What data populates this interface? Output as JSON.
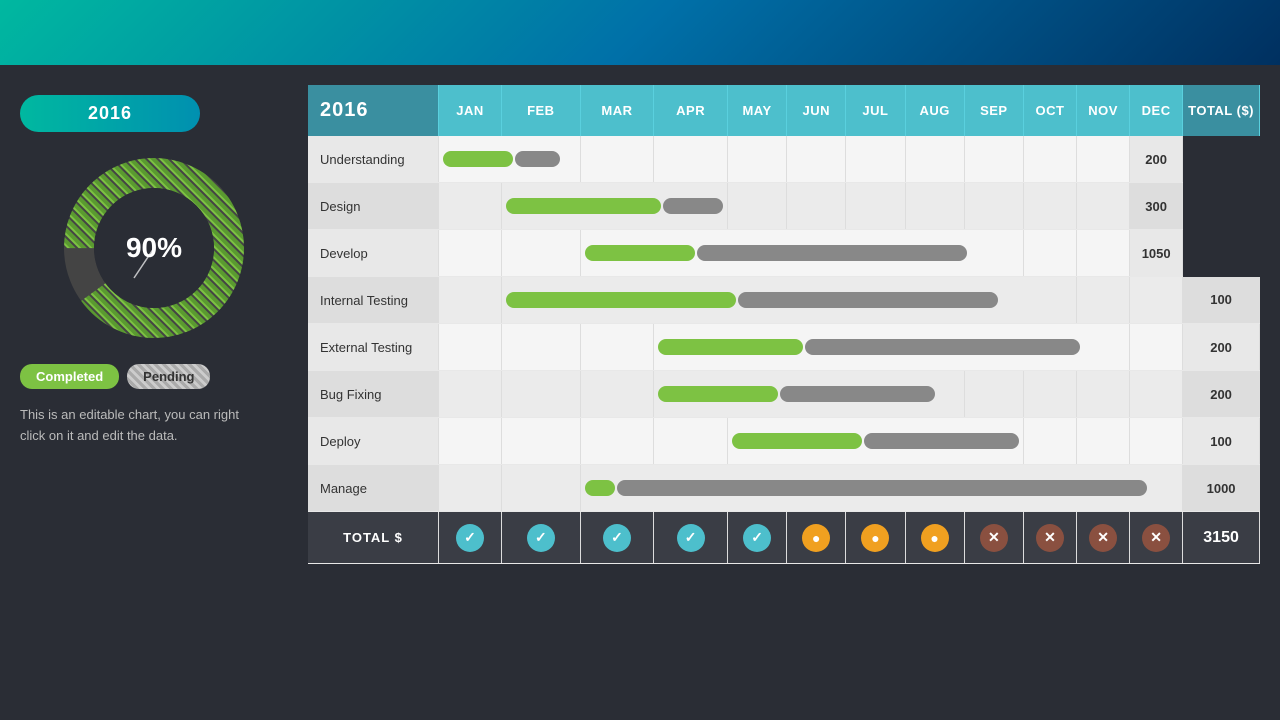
{
  "header": {
    "year": "2016"
  },
  "left_panel": {
    "year_label": "2016",
    "percentage": "90%",
    "legend": {
      "completed": "Completed",
      "pending": "Pending"
    },
    "description": "This is an editable chart, you can right click on it and edit the data."
  },
  "table": {
    "headers": [
      "2016",
      "JAN",
      "FEB",
      "MAR",
      "APR",
      "MAY",
      "JUN",
      "JUL",
      "AUG",
      "SEP",
      "OCT",
      "NOV",
      "DEC",
      "TOTAL ($)"
    ],
    "rows": [
      {
        "task": "Understanding",
        "total": "200",
        "bars": [
          {
            "month": "JAN",
            "green": 55,
            "gray": 40,
            "offset": 0
          },
          {
            "month": "FEB",
            "green": 0,
            "gray": 0,
            "offset": 0
          }
        ]
      },
      {
        "task": "Design",
        "total": "300",
        "bars": [
          {
            "month": "FEB",
            "green": 130,
            "gray": 60,
            "offset": 0
          }
        ]
      },
      {
        "task": "Develop",
        "total": "1050",
        "bars": [
          {
            "month": "MAR",
            "green": 90,
            "gray": 0,
            "offset": 0
          },
          {
            "month": "APR-SEP",
            "green": 0,
            "gray": 350,
            "offset": 0
          }
        ]
      },
      {
        "task": "Internal Testing",
        "total": "100",
        "bars": []
      },
      {
        "task": "External Testing",
        "total": "200",
        "bars": []
      },
      {
        "task": "Bug Fixing",
        "total": "200",
        "bars": []
      },
      {
        "task": "Deploy",
        "total": "100",
        "bars": []
      },
      {
        "task": "Manage",
        "total": "1000",
        "bars": []
      }
    ],
    "total_row": {
      "label": "TOTAL $",
      "value": "3150",
      "statuses": [
        "check",
        "check",
        "check",
        "check",
        "check",
        "pending",
        "pending",
        "pending",
        "x",
        "x",
        "x",
        "x"
      ]
    }
  },
  "donut": {
    "percentage": 90,
    "center_text": "90%"
  }
}
